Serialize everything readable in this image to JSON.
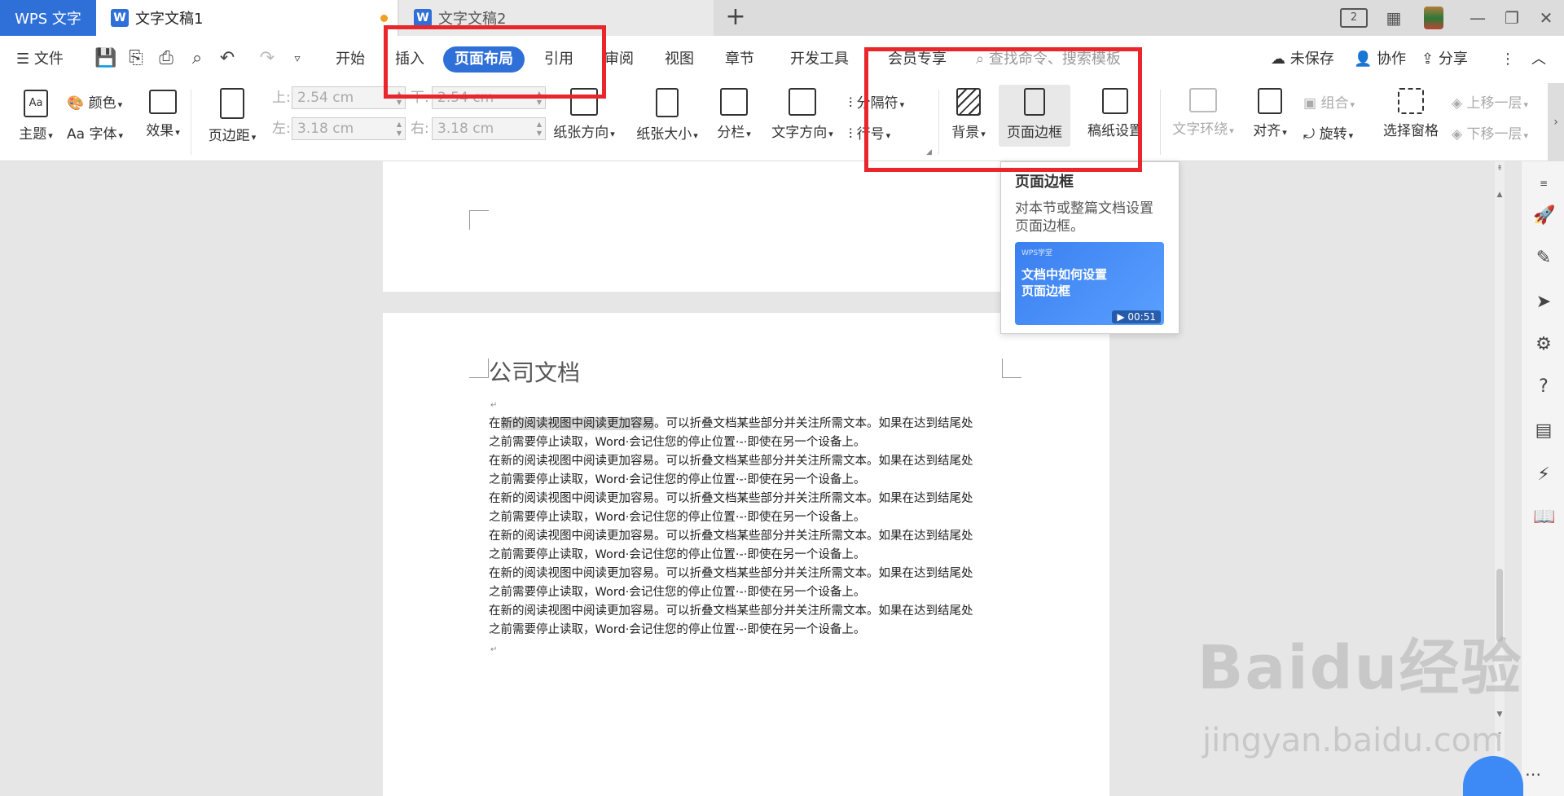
{
  "titlebar": {
    "app_tab": "WPS 文字",
    "tabs": [
      {
        "label": "文字文稿1",
        "icon": "W"
      },
      {
        "label": "文字文稿2",
        "icon": "W"
      }
    ],
    "new_tab": "+",
    "badge": "2"
  },
  "menubar": {
    "file": "文件",
    "items": [
      "开始",
      "插入",
      "页面布局",
      "引用",
      "审阅",
      "视图",
      "章节",
      "开发工具",
      "会员专享"
    ],
    "active": "页面布局",
    "search_placeholder": "查找命令、搜索模板",
    "unsaved": "未保存",
    "collab": "协作",
    "share": "分享"
  },
  "ribbon": {
    "theme": "主题",
    "color": "颜色",
    "font": "字体",
    "effect": "效果",
    "margins": "页边距",
    "top_label": "上:",
    "top_value": "2.54 cm",
    "bottom_label": "下:",
    "bottom_value": "2.54 cm",
    "left_label": "左:",
    "left_value": "3.18 cm",
    "right_label": "右:",
    "right_value": "3.18 cm",
    "orientation": "纸张方向",
    "size": "纸张大小",
    "columns": "分栏",
    "text_direction": "文字方向",
    "breaks": "分隔符",
    "line_numbers": "行号",
    "background": "背景",
    "page_border": "页面边框",
    "manuscript": "稿纸设置",
    "wrap_text": "文字环绕",
    "align": "对齐",
    "group": "组合",
    "rotate": "旋转",
    "selection_pane": "选择窗格",
    "bring_forward": "上移一层",
    "send_backward": "下移一层",
    "aa_glyph": "Aa"
  },
  "tooltip": {
    "title": "页面边框",
    "desc": "对本节或整篇文档设置页面边框。",
    "video_brand": "WPS学堂",
    "video_title": "文档中如何设置页面边框",
    "video_time": "00:51"
  },
  "document": {
    "title": "公司文档",
    "highlight": "新的阅读视图中阅读更加容易",
    "line1": "在新的阅读视图中阅读更加容易。可以折叠文档某些部分并关注所需文本。如果在达到结尾处",
    "line2": "之前需要停止读取，Word·会记住您的停止位置·-·即使在另一个设备上。",
    "line1_lead": "在",
    "line1_rest": "。可以折叠文档某些部分并关注所需文本。如果在达到结尾处",
    "para_mark": "↵"
  },
  "watermark": {
    "text": "Baidu经验",
    "sub": "jingyan.baidu.com"
  }
}
